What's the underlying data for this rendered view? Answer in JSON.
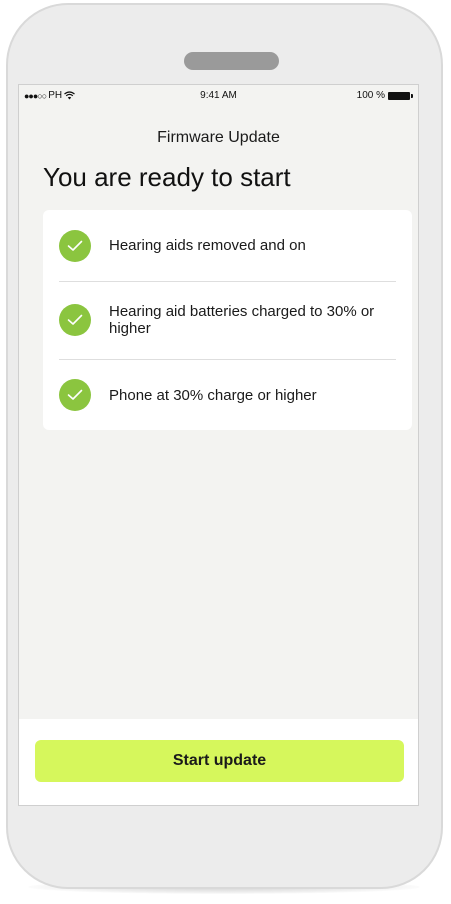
{
  "status_bar": {
    "carrier": "PH",
    "time": "9:41 AM",
    "battery": "100 %"
  },
  "header": {
    "title": "Firmware Update"
  },
  "main": {
    "heading": "You are ready to start",
    "checklist": [
      {
        "label": "Hearing aids removed and on",
        "icon": "check-icon",
        "checked": true
      },
      {
        "label": "Hearing aid batteries charged to 30% or higher",
        "icon": "check-icon",
        "checked": true
      },
      {
        "label": "Phone at 30% charge or higher",
        "icon": "check-icon",
        "checked": true
      }
    ]
  },
  "footer": {
    "primary_button": "Start update"
  },
  "colors": {
    "accent": "#d6f75c",
    "check": "#8bc53f",
    "background": "#f3f3f1"
  }
}
